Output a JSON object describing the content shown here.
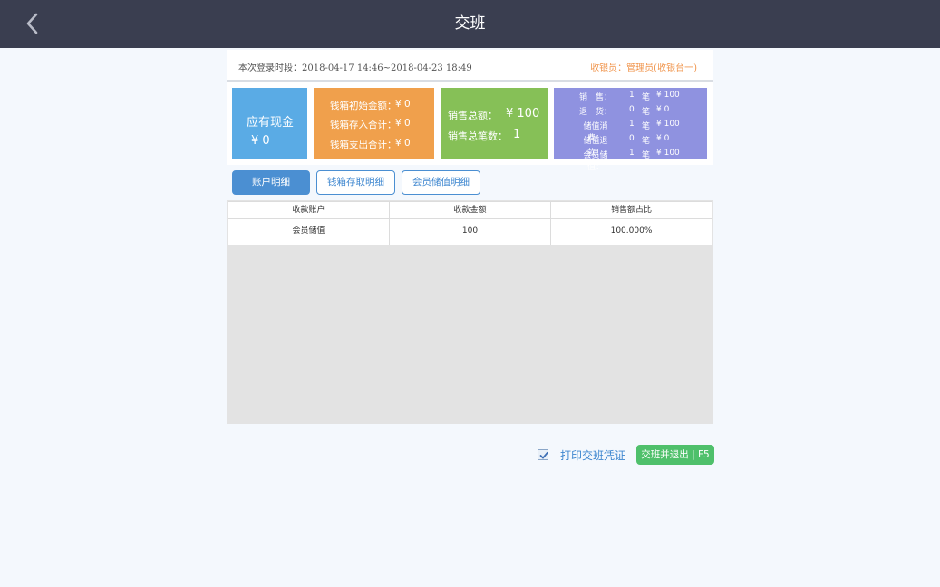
{
  "header": {
    "title": "交班"
  },
  "session": {
    "login_time": "本次登录时段：2018-04-17 14:46~2018-04-23 18:49",
    "cashier": "收银员：管理员(收银台一)"
  },
  "stats": {
    "cash": {
      "label": "应有现金",
      "value": "¥ 0"
    },
    "cashbox": [
      {
        "label": "钱箱初始金额：",
        "value": "¥ 0"
      },
      {
        "label": "钱箱存入合计：",
        "value": "¥ 0"
      },
      {
        "label": "钱箱支出合计：",
        "value": "¥ 0"
      }
    ],
    "sales": [
      {
        "label": "销售总额：",
        "value": "¥ 100"
      },
      {
        "label": "销售总笔数：",
        "value": "1"
      }
    ],
    "detail": [
      {
        "name": "销　售：",
        "count": "1",
        "unit": "笔",
        "amount": "¥ 100"
      },
      {
        "name": "退　货：",
        "count": "0",
        "unit": "笔",
        "amount": "¥ 0"
      },
      {
        "name": "储值消费：",
        "count": "1",
        "unit": "笔",
        "amount": "¥ 100"
      },
      {
        "name": "储值退款：",
        "count": "0",
        "unit": "笔",
        "amount": "¥ 0"
      },
      {
        "name": "会员储值：",
        "count": "1",
        "unit": "笔",
        "amount": "¥ 100"
      }
    ]
  },
  "tabs": [
    {
      "label": "账户明细",
      "active": true
    },
    {
      "label": "钱箱存取明细",
      "active": false
    },
    {
      "label": "会员储值明细",
      "active": false
    }
  ],
  "table": {
    "columns": [
      "收款账户",
      "收款金额",
      "销售额占比"
    ],
    "rows": [
      [
        "会员储值",
        "100",
        "100.000%"
      ]
    ]
  },
  "footer": {
    "print_label": "打印交班凭证",
    "print_checked": true,
    "submit_label": "交班并退出 | F5"
  }
}
